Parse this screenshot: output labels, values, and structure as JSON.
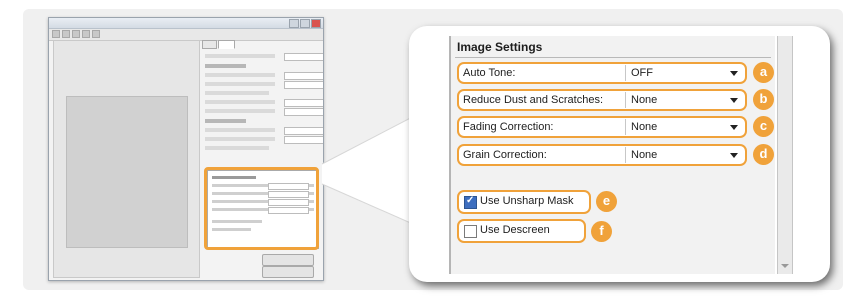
{
  "callout": {
    "title": "Image Settings",
    "settings": [
      {
        "label": "Auto Tone:",
        "value": "OFF",
        "badge": "a"
      },
      {
        "label": "Reduce Dust and Scratches:",
        "value": "None",
        "badge": "b"
      },
      {
        "label": "Fading Correction:",
        "value": "None",
        "badge": "c"
      },
      {
        "label": "Grain Correction:",
        "value": "None",
        "badge": "d"
      }
    ],
    "checkboxes": [
      {
        "label": "Use Unsharp Mask",
        "checked": true,
        "badge": "e"
      },
      {
        "label": "Use Descreen",
        "checked": false,
        "badge": "f"
      }
    ]
  },
  "colors": {
    "highlight": "#f0a23a",
    "checkbox_checked": "#3d6ebf"
  }
}
